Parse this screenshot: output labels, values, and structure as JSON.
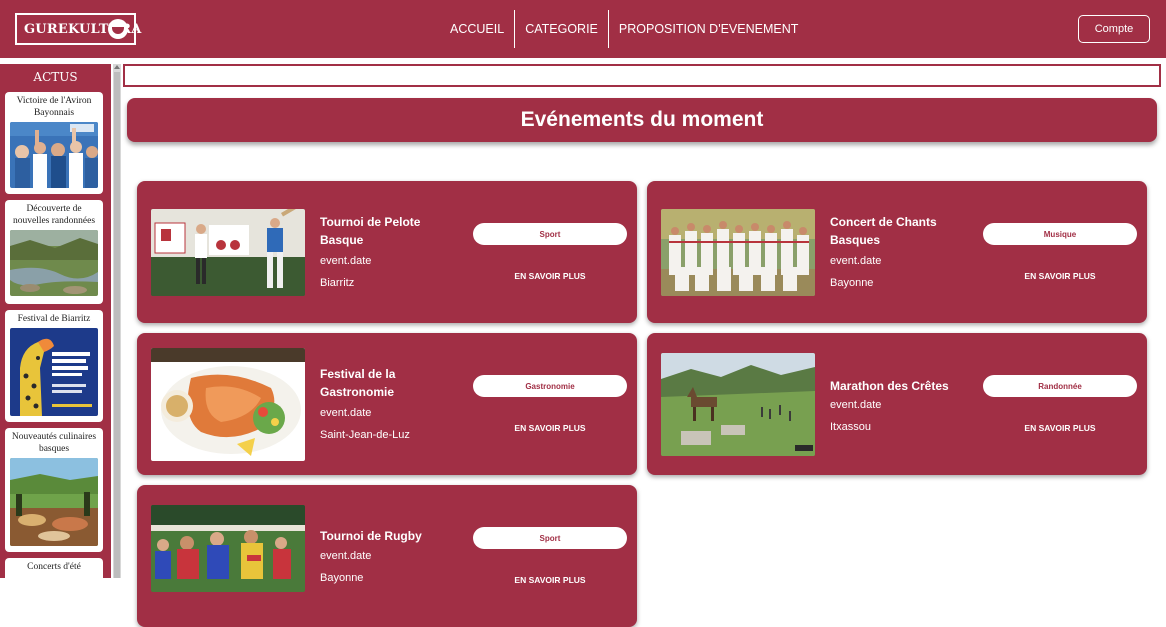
{
  "header": {
    "logo_text": "GUREKULTURA",
    "nav": [
      {
        "label": "ACCUEIL"
      },
      {
        "label": "CATEGORIE"
      },
      {
        "label": "PROPOSITION D'EVENEMENT"
      }
    ],
    "account_label": "Compte"
  },
  "sidebar": {
    "title": "ACTUS",
    "items": [
      {
        "title": "Victoire de l'Aviron Bayonnais",
        "image": "rugby-fans-photo"
      },
      {
        "title": "Découverte de nouvelles randonnées",
        "image": "river-valley-photo"
      },
      {
        "title": "Festival de Biarritz",
        "image": "festival-poster"
      },
      {
        "title": "Nouveautés culinaires basques",
        "image": "basque-food-photo"
      },
      {
        "title": "Concerts d'été",
        "image": "concert-photo"
      }
    ]
  },
  "search": {
    "placeholder": ""
  },
  "main": {
    "title": "Evénements du moment",
    "events": [
      {
        "title": "Tournoi de Pelote Basque",
        "date": "event.date",
        "location": "Biarritz",
        "category": "Sport",
        "more": "EN SAVOIR PLUS",
        "image": "pelote-player-photo"
      },
      {
        "title": "Concert de Chants Basques",
        "date": "event.date",
        "location": "Bayonne",
        "category": "Musique",
        "more": "EN SAVOIR PLUS",
        "image": "choir-group-photo"
      },
      {
        "title": "Festival de la Gastronomie",
        "date": "event.date",
        "location": "Saint-Jean-de-Luz",
        "category": "Gastronomie",
        "more": "EN SAVOIR PLUS",
        "image": "seafood-plate-photo"
      },
      {
        "title": "Marathon des Crêtes",
        "date": "event.date",
        "location": "Itxassou",
        "category": "Randonnée",
        "more": "EN SAVOIR PLUS",
        "image": "mountain-horses-photo"
      },
      {
        "title": "Tournoi de Rugby",
        "date": "event.date",
        "location": "Bayonne",
        "category": "Sport",
        "more": "EN SAVOIR PLUS",
        "image": "rugby-scrum-photo"
      }
    ]
  },
  "colors": {
    "brand": "#a12f45",
    "background": "#ffffff"
  }
}
